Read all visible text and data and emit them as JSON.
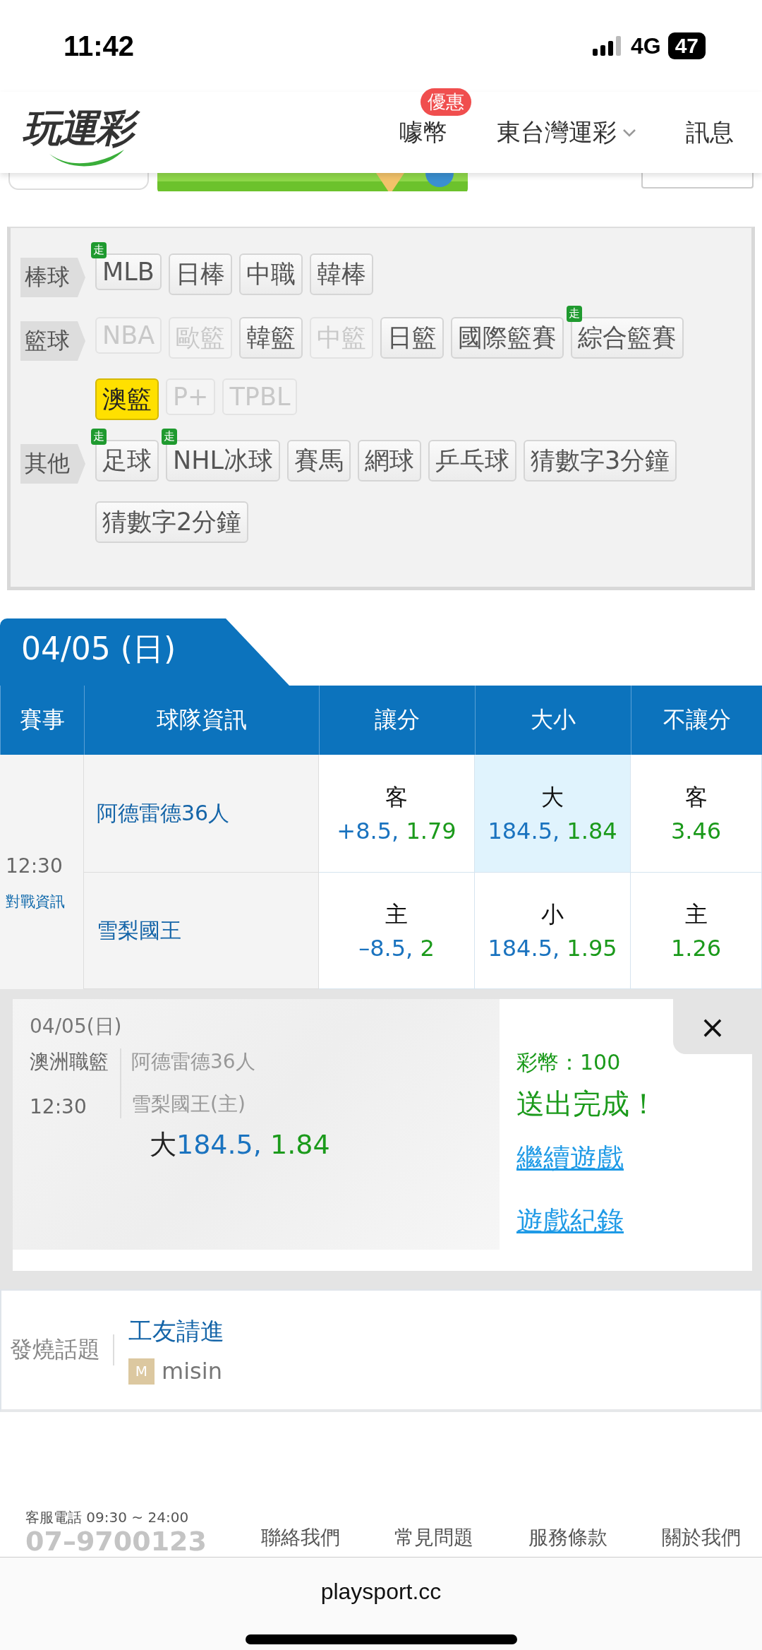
{
  "status_bar": {
    "time": "11:42",
    "network": "4G",
    "battery": "47"
  },
  "header": {
    "logo": "玩運彩",
    "nav": [
      {
        "label": "噱幣",
        "badge": "優惠",
        "dropdown": false
      },
      {
        "label": "東台灣運彩",
        "dropdown": true
      },
      {
        "label": "訊息",
        "dropdown": false
      }
    ]
  },
  "categories": [
    {
      "label": "棒球",
      "items": [
        {
          "label": "MLB",
          "badge": "走",
          "selected": false,
          "disabled": false
        },
        {
          "label": "日棒",
          "selected": false,
          "disabled": false
        },
        {
          "label": "中職",
          "selected": false,
          "disabled": false
        },
        {
          "label": "韓棒",
          "selected": false,
          "disabled": false
        }
      ]
    },
    {
      "label": "籃球",
      "items": [
        {
          "label": "NBA",
          "selected": false,
          "disabled": true
        },
        {
          "label": "歐籃",
          "selected": false,
          "disabled": true
        },
        {
          "label": "韓籃",
          "selected": false,
          "disabled": false
        },
        {
          "label": "中籃",
          "selected": false,
          "disabled": true
        },
        {
          "label": "日籃",
          "selected": false,
          "disabled": false
        },
        {
          "label": "國際籃賽",
          "selected": false,
          "disabled": false
        },
        {
          "label": "綜合籃賽",
          "badge": "走",
          "selected": false,
          "disabled": false
        },
        {
          "label": "澳籃",
          "selected": true,
          "disabled": false
        },
        {
          "label": "P+",
          "selected": false,
          "disabled": true
        },
        {
          "label": "TPBL",
          "selected": false,
          "disabled": true
        }
      ]
    },
    {
      "label": "其他",
      "items": [
        {
          "label": "足球",
          "badge": "走",
          "selected": false,
          "disabled": false
        },
        {
          "label": "NHL冰球",
          "badge": "走",
          "selected": false,
          "disabled": false
        },
        {
          "label": "賽馬",
          "selected": false,
          "disabled": false
        },
        {
          "label": "網球",
          "selected": false,
          "disabled": false
        },
        {
          "label": "乒乓球",
          "selected": false,
          "disabled": false
        },
        {
          "label": "猜數字3分鐘",
          "selected": false,
          "disabled": false
        },
        {
          "label": "猜數字2分鐘",
          "selected": false,
          "disabled": false
        }
      ]
    }
  ],
  "date_tab": "04/05 (日)",
  "table": {
    "columns": [
      "賽事",
      "球隊資訊",
      "讓分",
      "大小",
      "不讓分"
    ],
    "match": {
      "time": "12:30",
      "info_link": "對戰資訊",
      "teams": [
        {
          "name": "阿德雷德36人",
          "cells": [
            {
              "label": "客",
              "line": "+8.5, ",
              "odds": "1.79",
              "selected": false
            },
            {
              "label": "大",
              "line": "184.5, ",
              "odds": "1.84",
              "selected": true
            },
            {
              "label": "客",
              "odds": "3.46",
              "selected": false
            }
          ]
        },
        {
          "name": "雪梨國王",
          "cells": [
            {
              "label": "主",
              "line": "–8.5, ",
              "odds": "2",
              "selected": false
            },
            {
              "label": "小",
              "line": "184.5, ",
              "odds": "1.95",
              "selected": false
            },
            {
              "label": "主",
              "odds": "1.26",
              "selected": false
            }
          ]
        }
      ]
    }
  },
  "receipt": {
    "date": "04/05(日)",
    "league": "澳洲職籃",
    "time": "12:30",
    "teams": [
      "阿德雷德36人",
      "雪梨國王(主)"
    ],
    "pick": {
      "label": "大",
      "line": "184.5, ",
      "odds": "1.84"
    },
    "coins": "彩幣：100",
    "message": "送出完成！",
    "links": [
      "繼續遊戲",
      "遊戲紀錄"
    ],
    "close": "×"
  },
  "hot_topics": {
    "label": "發燒話題",
    "title": "工友請進",
    "avatar": "M",
    "user": "misin"
  },
  "footer": {
    "service": "客服電話 09:30 ~ 24:00",
    "phone": "07–9700123",
    "links": [
      "聯絡我們",
      "常見問題",
      "服務條款",
      "關於我們"
    ]
  },
  "browser": {
    "url": "playsport.cc"
  }
}
